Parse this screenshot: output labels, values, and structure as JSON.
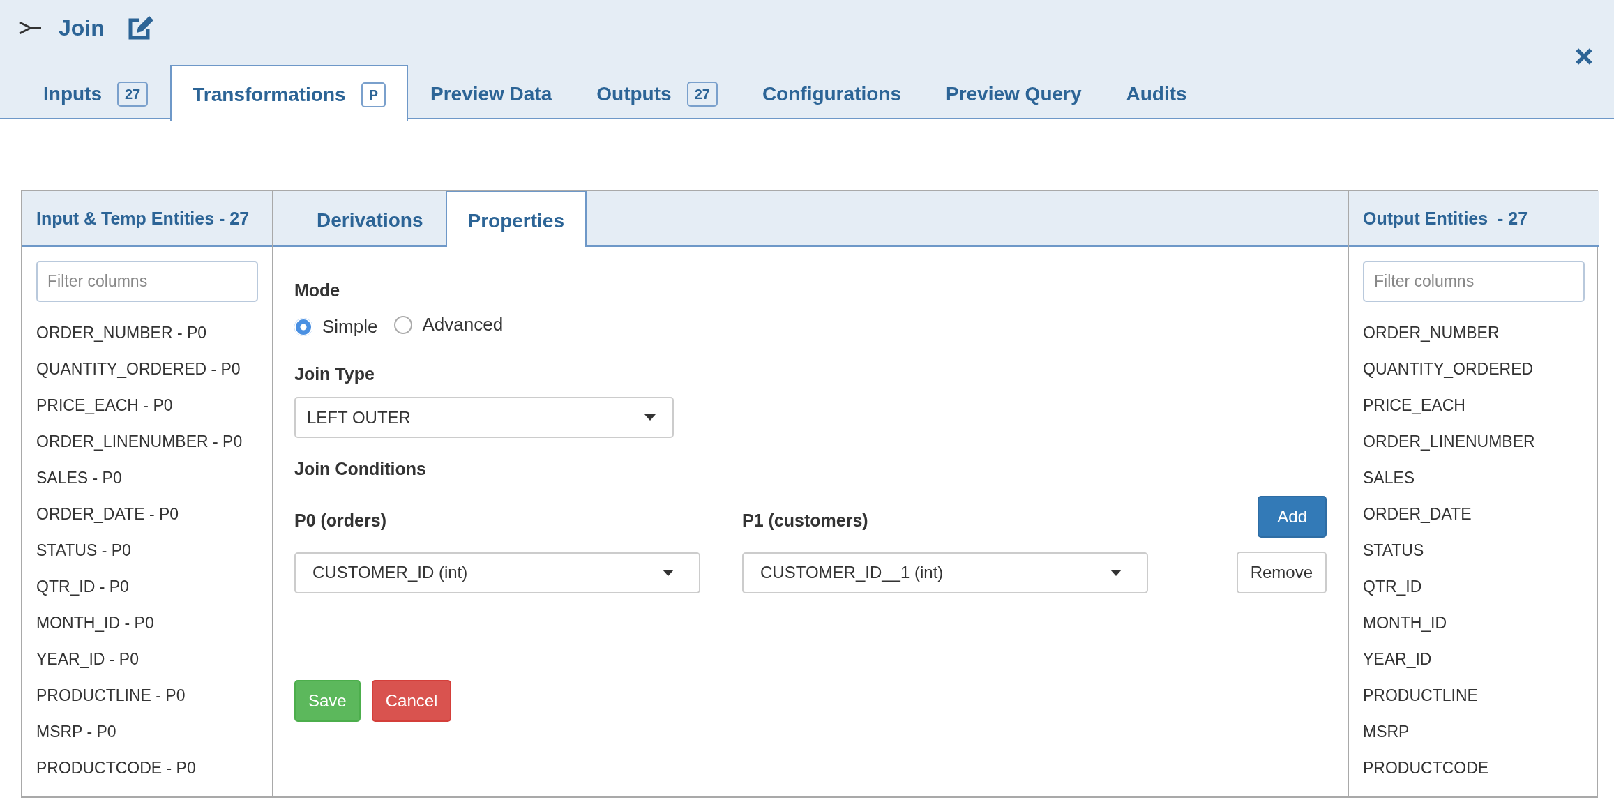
{
  "header": {
    "title": "Join"
  },
  "tabs": [
    {
      "label": "Inputs",
      "badge": "27",
      "selected": false
    },
    {
      "label": "Transformations",
      "badge": "P",
      "selected": true
    },
    {
      "label": "Preview Data",
      "selected": false
    },
    {
      "label": "Outputs",
      "badge": "27",
      "selected": false
    },
    {
      "label": "Configurations",
      "selected": false
    },
    {
      "label": "Preview Query",
      "selected": false
    },
    {
      "label": "Audits",
      "selected": false
    }
  ],
  "input_panel": {
    "title": "Input & Temp Entities - 27",
    "filter": {
      "placeholder": "Filter columns"
    },
    "items": [
      "ORDER_NUMBER - P0",
      "QUANTITY_ORDERED - P0",
      "PRICE_EACH - P0",
      "ORDER_LINENUMBER - P0",
      "SALES - P0",
      "ORDER_DATE - P0",
      "STATUS - P0",
      "QTR_ID - P0",
      "MONTH_ID - P0",
      "YEAR_ID - P0",
      "PRODUCTLINE - P0",
      "MSRP - P0",
      "PRODUCTCODE - P0"
    ]
  },
  "sub_tabs": [
    {
      "label": "Derivations",
      "selected": false
    },
    {
      "label": "Properties",
      "selected": true
    }
  ],
  "properties": {
    "mode_label": "Mode",
    "modes": [
      {
        "label": "Simple",
        "selected": true
      },
      {
        "label": "Advanced",
        "selected": false
      }
    ],
    "join_type_label": "Join Type",
    "join_type": "LEFT OUTER",
    "conditions_label": "Join Conditions",
    "left_label": "P0 (orders)",
    "right_label": "P1 (customers)",
    "conditions": [
      {
        "left": "CUSTOMER_ID (int)",
        "right": "CUSTOMER_ID__1 (int)",
        "action": "Remove"
      }
    ],
    "add_button": "Add",
    "save_button": "Save",
    "cancel_button": "Cancel"
  },
  "output_panel": {
    "title": "Output Entities  - 27",
    "filter": {
      "placeholder": "Filter columns"
    },
    "items": [
      "ORDER_NUMBER",
      "QUANTITY_ORDERED",
      "PRICE_EACH",
      "ORDER_LINENUMBER",
      "SALES",
      "ORDER_DATE",
      "STATUS",
      "QTR_ID",
      "MONTH_ID",
      "YEAR_ID",
      "PRODUCTLINE",
      "MSRP",
      "PRODUCTCODE"
    ]
  }
}
